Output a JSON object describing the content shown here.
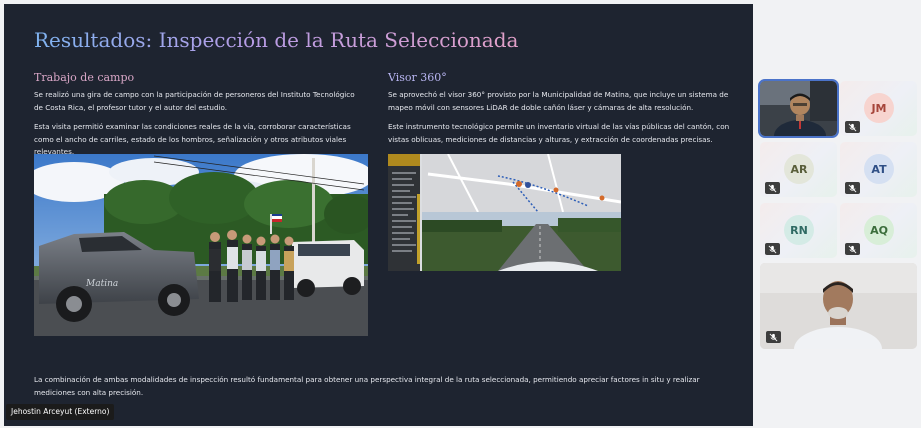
{
  "slide": {
    "title": "Resultados: Inspección de la Ruta Seleccionada",
    "left": {
      "heading": "Trabajo de campo",
      "p1": "Se realizó una gira de campo con la participación de personeros del Instituto Tecnológico de Costa Rica, el profesor tutor y el autor del estudio.",
      "p2": "Esta visita permitió examinar las condiciones reales de la vía, corroborar características como el ancho de carriles, estado de los hombros, señalización y otros atributos viales relevantes."
    },
    "right": {
      "heading": "Visor 360°",
      "p1": "Se aprovechó el visor 360° provisto por la Municipalidad de Matina, que incluye un sistema de mapeo móvil con sensores LiDAR de doble cañón láser y cámaras de alta resolución.",
      "p2": "Este instrumento tecnológico permite un inventario virtual de las vías públicas del cantón, con vistas oblicuas, mediciones de distancias y alturas, y extracción de coordenadas precisas."
    },
    "bottom": "La combinación de ambas modalidades de inspección resultó fundamental para obtener una perspectiva integral de la ruta seleccionada, permitiendo apreciar factores in situ y realizar mediciones con alta precisión.",
    "truck_logo_text": "Matina"
  },
  "presenter_name": "Jehostin Arceyut (Externo)",
  "participants": [
    {
      "initials": "JM",
      "avatar_bg": "#f7d4cf",
      "text_color": "#a6453a",
      "muted": true
    },
    {
      "initials": "AR",
      "avatar_bg": "#e3e6da",
      "text_color": "#5a5f3b",
      "muted": true
    },
    {
      "initials": "AT",
      "avatar_bg": "#d5e0f2",
      "text_color": "#2f4f86",
      "muted": true
    },
    {
      "initials": "RN",
      "avatar_bg": "#d4ebe6",
      "text_color": "#2f6a63",
      "muted": true
    },
    {
      "initials": "AQ",
      "avatar_bg": "#d8eed8",
      "text_color": "#3b6d3b",
      "muted": true
    }
  ],
  "colors": {
    "slide_bg": "#1e2430",
    "active_speaker_outline": "#4b73c9"
  }
}
